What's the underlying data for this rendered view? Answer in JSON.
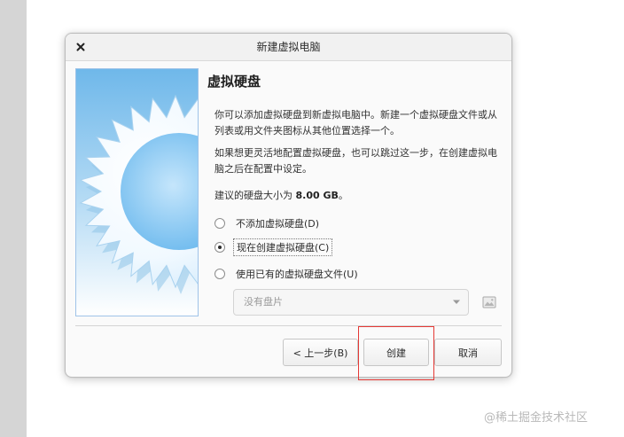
{
  "window": {
    "title": "新建虚拟电脑",
    "close_icon": "close-icon"
  },
  "page": {
    "heading": "虚拟硬盘",
    "paragraph1": "你可以添加虚拟硬盘到新虚拟电脑中。新建一个虚拟硬盘文件或从列表或用文件夹图标从其他位置选择一个。",
    "paragraph2": "如果想更灵活地配置虚拟硬盘，也可以跳过这一步，在创建虚拟电脑之后在配置中设定。",
    "recommend_prefix": "建议的硬盘大小为 ",
    "recommend_size": "8.00 GB",
    "recommend_suffix": "。"
  },
  "options": [
    {
      "label": "不添加虚拟硬盘(D)",
      "checked": false
    },
    {
      "label": "现在创建虚拟硬盘(C)",
      "checked": true
    },
    {
      "label": "使用已有的虚拟硬盘文件(U)",
      "checked": false
    }
  ],
  "disk_select": {
    "value": "没有盘片",
    "icon": "chevron-down-icon"
  },
  "folder_button": {
    "icon": "folder-image-icon"
  },
  "buttons": {
    "back": "< 上一步(B)",
    "create": "创建",
    "cancel": "取消"
  },
  "watermark": "@稀土掘金技术社区",
  "colors": {
    "highlight": "#e53935",
    "illustration_blue": "#7ec3f2"
  }
}
